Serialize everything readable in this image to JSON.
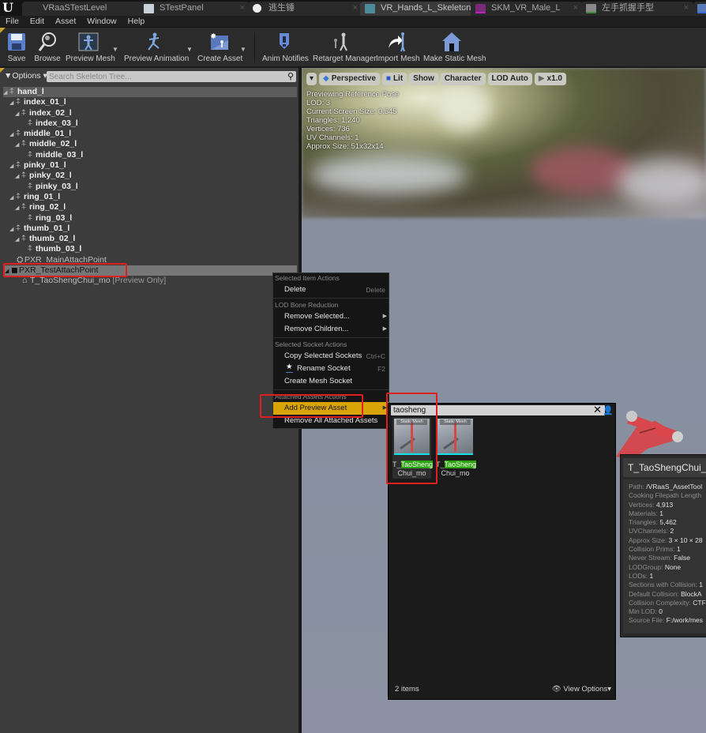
{
  "tabs": [
    {
      "label": "VRaaSTestLevel",
      "icon": "level-icon",
      "active": false
    },
    {
      "label": "STestPanel",
      "icon": "widget-blueprint-icon",
      "active": false
    },
    {
      "label": "逃生锤",
      "icon": "static-mesh-icon",
      "active": false
    },
    {
      "label": "VR_Hands_L_Skeleton",
      "icon": "skeleton-icon",
      "active": true
    },
    {
      "label": "SKM_VR_Male_L",
      "icon": "skeletal-mesh-icon",
      "active": false
    },
    {
      "label": "左手抓握手型",
      "icon": "pose-asset-icon",
      "active": false
    }
  ],
  "menu": [
    "File",
    "Edit",
    "Asset",
    "Window",
    "Help"
  ],
  "toolbar": {
    "save": "Save",
    "browse": "Browse",
    "preview_mesh": "Preview Mesh",
    "preview_animation": "Preview Animation",
    "create_asset": "Create Asset",
    "anim_notifies": "Anim Notifies",
    "retarget_manager": "Retarget Manager",
    "import_mesh": "Import Mesh",
    "make_static_mesh": "Make Static Mesh"
  },
  "skeleton_tree": {
    "options_label": "Options",
    "search_placeholder": "Search Skeleton Tree...",
    "rows": [
      {
        "label": "hand_l",
        "level": 0,
        "expanded": true,
        "type": "bone"
      },
      {
        "label": "index_01_l",
        "level": 1,
        "expanded": true,
        "type": "bone"
      },
      {
        "label": "index_02_l",
        "level": 2,
        "expanded": true,
        "type": "bone"
      },
      {
        "label": "index_03_l",
        "level": 3,
        "expanded": false,
        "type": "bone"
      },
      {
        "label": "middle_01_l",
        "level": 1,
        "expanded": true,
        "type": "bone"
      },
      {
        "label": "middle_02_l",
        "level": 2,
        "expanded": true,
        "type": "bone"
      },
      {
        "label": "middle_03_l",
        "level": 3,
        "expanded": false,
        "type": "bone"
      },
      {
        "label": "pinky_01_l",
        "level": 1,
        "expanded": true,
        "type": "bone"
      },
      {
        "label": "pinky_02_l",
        "level": 2,
        "expanded": true,
        "type": "bone"
      },
      {
        "label": "pinky_03_l",
        "level": 3,
        "expanded": false,
        "type": "bone"
      },
      {
        "label": "ring_01_l",
        "level": 1,
        "expanded": true,
        "type": "bone"
      },
      {
        "label": "ring_02_l",
        "level": 2,
        "expanded": true,
        "type": "bone"
      },
      {
        "label": "ring_03_l",
        "level": 3,
        "expanded": false,
        "type": "bone"
      },
      {
        "label": "thumb_01_l",
        "level": 1,
        "expanded": true,
        "type": "bone"
      },
      {
        "label": "thumb_02_l",
        "level": 2,
        "expanded": true,
        "type": "bone"
      },
      {
        "label": "thumb_03_l",
        "level": 3,
        "expanded": false,
        "type": "bone"
      },
      {
        "label": "PXR_MainAttachPoint",
        "level": 1,
        "expanded": false,
        "type": "socket"
      },
      {
        "label": "PXR_TestAttachPoint",
        "level": 0,
        "expanded": true,
        "type": "socket-selected"
      },
      {
        "label": "T_TaoShengChui_mo",
        "suffix": "[Preview Only]",
        "level": 2,
        "expanded": false,
        "type": "preview-asset"
      }
    ]
  },
  "viewport": {
    "buttons": {
      "perspective": "Perspective",
      "lit": "Lit",
      "show": "Show",
      "character": "Character",
      "lod": "LOD Auto",
      "speed": "x1.0"
    },
    "stats": [
      "Previewing Reference Pose",
      "LOD: 3",
      "Current Screen Size: 0.545",
      "Triangles: 1,240",
      "Vertices: 736",
      "UV Channels: 1",
      "Approx Size: 51x32x14"
    ]
  },
  "context_menu": {
    "sections": [
      {
        "header": "Selected Item Actions",
        "items": [
          {
            "label": "Delete",
            "shortcut": "Delete"
          }
        ]
      },
      {
        "header": "LOD Bone Reduction",
        "items": [
          {
            "label": "Remove Selected...",
            "submenu": true
          },
          {
            "label": "Remove Children...",
            "submenu": true
          }
        ]
      },
      {
        "header": "Selected Socket Actions",
        "items": [
          {
            "label": "Copy Selected Sockets",
            "shortcut": "Ctrl+C"
          },
          {
            "label": "Rename Socket",
            "shortcut": "F2",
            "icon": "rename-star-icon"
          },
          {
            "label": "Create Mesh Socket"
          }
        ]
      },
      {
        "header": "Attached Assets Actions",
        "items": [
          {
            "label": "Add Preview Asset",
            "submenu": true,
            "active": true
          },
          {
            "label": "Remove All Attached Assets"
          }
        ]
      }
    ]
  },
  "asset_picker": {
    "search_value": "taosheng",
    "assets": [
      {
        "type_tag": "Static Mesh",
        "name_prefix": "T_",
        "name_match": "TaoSheng",
        "name_suffix": "Chui_mo",
        "selected": true
      },
      {
        "type_tag": "Static Mesh",
        "name_prefix": "T_",
        "name_match": "TaoSheng",
        "name_suffix": "Chui_mo",
        "selected": false
      }
    ],
    "item_count": "2 items",
    "view_options": "View Options"
  },
  "tooltip": {
    "title": "T_TaoShengChui_mo",
    "lines": [
      {
        "key": "Path:",
        "value": "/VRaaS_AssetTool"
      },
      {
        "key": "Cooking Filepath Length",
        "value": ""
      },
      {
        "key": "Vertices:",
        "value": "4,913"
      },
      {
        "key": "Materials:",
        "value": "1"
      },
      {
        "key": "Triangles:",
        "value": "5,462"
      },
      {
        "key": "UVChannels:",
        "value": "2"
      },
      {
        "key": "Approx Size:",
        "value": "3 × 10 × 28"
      },
      {
        "key": "Collision Prims:",
        "value": "1"
      },
      {
        "key": "Never Stream:",
        "value": "False"
      },
      {
        "key": "LODGroup:",
        "value": "None"
      },
      {
        "key": "LODs:",
        "value": "1"
      },
      {
        "key": "Sections with Collision:",
        "value": "1"
      },
      {
        "key": "Default Collision:",
        "value": "BlockA"
      },
      {
        "key": "Collision Complexity:",
        "value": "CTF"
      },
      {
        "key": "Min LOD:",
        "value": "0"
      },
      {
        "key": "Source File:",
        "value": "F:/work/mes"
      }
    ]
  },
  "colors": {
    "highlight_menu": "#d9a408",
    "annotation_red": "#e02020",
    "search_match": "#2aa30c",
    "thumbnail_underline": "#13e0e8"
  }
}
